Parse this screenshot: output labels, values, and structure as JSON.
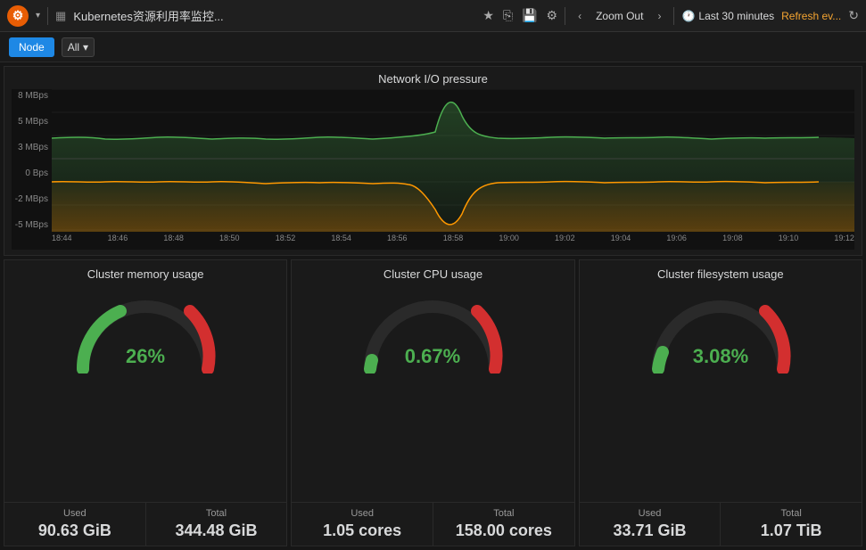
{
  "topbar": {
    "logo": "⚙",
    "title": "Kubernetes资源利用率监控...",
    "star_icon": "★",
    "share_icon": "⎘",
    "save_icon": "💾",
    "settings_icon": "⚙",
    "zoom_out_label": "Zoom Out",
    "zoom_in_label": ">",
    "time_label": "Last 30 minutes",
    "refresh_label": "Refresh ev...",
    "refresh_icon": "↻"
  },
  "filterbar": {
    "node_label": "Node",
    "all_label": "All",
    "dropdown_arrow": "▾"
  },
  "network_chart": {
    "title": "Network I/O pressure",
    "y_labels": [
      "8 MBps",
      "5 MBps",
      "3 MBps",
      "0 Bps",
      "-2 MBps",
      "-5 MBps"
    ],
    "x_labels": [
      "18:44",
      "18:46",
      "18:48",
      "18:50",
      "18:52",
      "18:54",
      "18:56",
      "18:58",
      "19:00",
      "19:02",
      "19:04",
      "19:06",
      "19:08",
      "19:10",
      "19:12"
    ]
  },
  "gauges": [
    {
      "title": "Cluster memory usage",
      "value": "26%",
      "percent": 26,
      "used_label": "Used",
      "total_label": "Total",
      "used_value": "90.63 GiB",
      "total_value": "344.48 GiB"
    },
    {
      "title": "Cluster CPU usage",
      "value": "0.67%",
      "percent": 0.67,
      "used_label": "Used",
      "total_label": "Total",
      "used_value": "1.05 cores",
      "total_value": "158.00 cores"
    },
    {
      "title": "Cluster filesystem usage",
      "value": "3.08%",
      "percent": 3.08,
      "used_label": "Used",
      "total_label": "Total",
      "used_value": "33.71 GiB",
      "total_value": "1.07 TiB"
    }
  ]
}
